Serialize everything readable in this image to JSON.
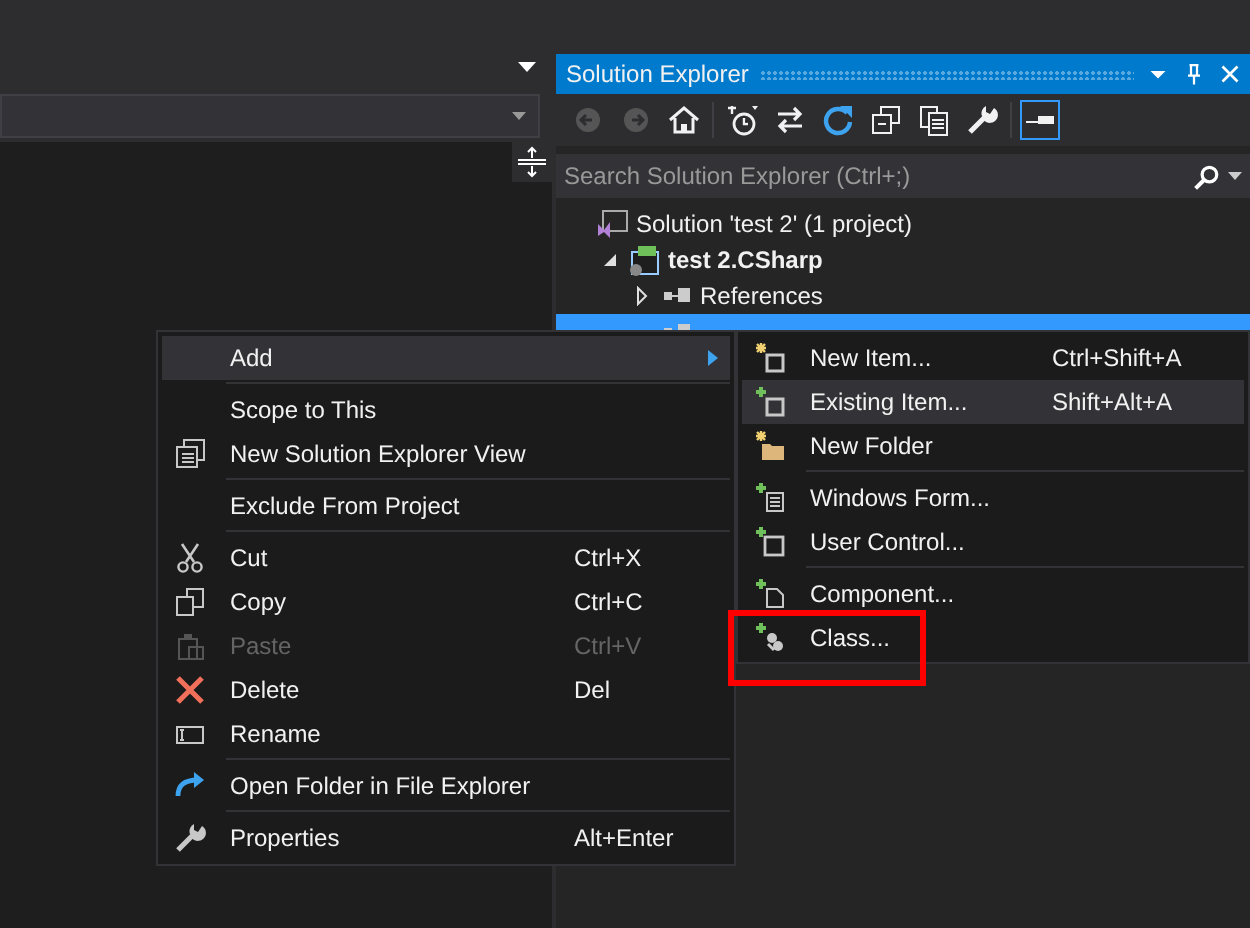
{
  "solution_explorer": {
    "title": "Solution Explorer",
    "toolbar": [
      {
        "disabled": true,
        "on": false
      },
      {
        "disabled": true,
        "on": false
      },
      {
        "disabled": false,
        "on": false
      },
      {
        "disabled": false,
        "on": false
      },
      {
        "disabled": false,
        "on": false
      },
      {
        "disabled": false,
        "on": false
      },
      {
        "disabled": false,
        "on": false
      },
      {
        "disabled": false,
        "on": false
      },
      {
        "disabled": false,
        "on": false
      },
      {
        "disabled": false,
        "on": true
      }
    ],
    "search": {
      "placeholder": "Search Solution Explorer (Ctrl+;)"
    },
    "tree": [
      {
        "label": "Solution 'test 2' (1 project)",
        "bold": false,
        "selected": false,
        "children": [
          {
            "label": "test 2.CSharp",
            "bold": true,
            "expanded": true,
            "selected": false,
            "children": [
              {
                "label": "References",
                "bold": false,
                "expanded": false,
                "selected": false
              },
              {
                "selected": true
              }
            ]
          }
        ]
      }
    ]
  },
  "context_menu": {
    "items": [
      {
        "kind": "item",
        "label": "Add",
        "submenu": true,
        "selected": true,
        "disabled": false
      },
      {
        "kind": "separator"
      },
      {
        "kind": "item",
        "label": "Scope to This",
        "selected": false,
        "disabled": false
      },
      {
        "kind": "item",
        "label": "New Solution Explorer View",
        "selected": false,
        "disabled": false
      },
      {
        "kind": "separator"
      },
      {
        "kind": "item",
        "label": "Exclude From Project",
        "selected": false,
        "disabled": false
      },
      {
        "kind": "separator"
      },
      {
        "kind": "item",
        "label": "Cut",
        "shortcut": "Ctrl+X",
        "selected": false,
        "disabled": false
      },
      {
        "kind": "item",
        "label": "Copy",
        "shortcut": "Ctrl+C",
        "selected": false,
        "disabled": false
      },
      {
        "kind": "item",
        "label": "Paste",
        "shortcut": "Ctrl+V",
        "selected": false,
        "disabled": true
      },
      {
        "kind": "item",
        "label": "Delete",
        "shortcut": "Del",
        "selected": false,
        "disabled": false
      },
      {
        "kind": "item",
        "label": "Rename",
        "selected": false,
        "disabled": false
      },
      {
        "kind": "separator"
      },
      {
        "kind": "item",
        "label": "Open Folder in File Explorer",
        "selected": false,
        "disabled": false
      },
      {
        "kind": "separator"
      },
      {
        "kind": "item",
        "label": "Properties",
        "shortcut": "Alt+Enter",
        "selected": false,
        "disabled": false
      }
    ]
  },
  "add_submenu": {
    "items": [
      {
        "kind": "item",
        "label": "New Item...",
        "shortcut": "Ctrl+Shift+A",
        "selected": false,
        "disabled": false
      },
      {
        "kind": "item",
        "label": "Existing Item...",
        "shortcut": "Shift+Alt+A",
        "selected": true,
        "disabled": false
      },
      {
        "kind": "item",
        "label": "New Folder",
        "selected": false,
        "disabled": false
      },
      {
        "kind": "separator"
      },
      {
        "kind": "item",
        "label": "Windows Form...",
        "selected": false,
        "disabled": false
      },
      {
        "kind": "item",
        "label": "User Control...",
        "selected": false,
        "disabled": false
      },
      {
        "kind": "separator"
      },
      {
        "kind": "item",
        "label": "Component...",
        "selected": false,
        "disabled": false
      },
      {
        "kind": "item",
        "label": "Class...",
        "selected": false,
        "disabled": false
      }
    ]
  },
  "annotation": {
    "kind": "highlight-frame"
  }
}
